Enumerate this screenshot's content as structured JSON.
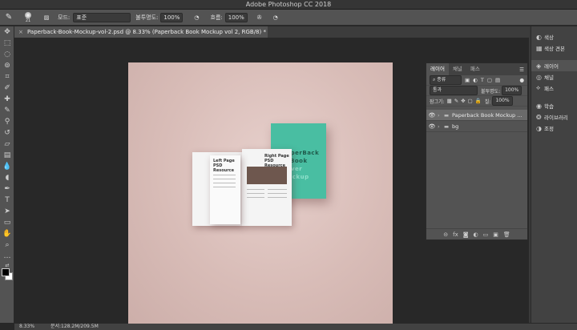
{
  "app": {
    "title": "Adobe Photoshop CC 2018"
  },
  "options_bar": {
    "brush_size": "21",
    "mode_label": "모드:",
    "mode_value": "표준",
    "opacity_label": "불투명도:",
    "opacity_value": "100%",
    "flow_label": "흐름:",
    "flow_value": "100%"
  },
  "document": {
    "tab_title": "Paperback-Book-Mockup-vol-2.psd @ 8.33% (Paperback Book Mockup vol 2, RGB/8) *",
    "close_glyph": "×"
  },
  "mockup": {
    "cover_lines": [
      "PaperBack",
      "Book",
      "Cover",
      "Mockup"
    ],
    "left_page_title": [
      "Left Page",
      "PSD Resource"
    ],
    "right_page_title": [
      "Right Page",
      "PSD Resource"
    ]
  },
  "right_dock": {
    "items": [
      {
        "icon": "◐",
        "label": "색상"
      },
      {
        "icon": "▦",
        "label": "색상 견본"
      },
      {
        "icon": "◈",
        "label": "레이어"
      },
      {
        "icon": "◎",
        "label": "채널"
      },
      {
        "icon": "⟡",
        "label": "패스"
      },
      {
        "icon": "◉",
        "label": "학습"
      },
      {
        "icon": "❂",
        "label": "라이브러리"
      },
      {
        "icon": "◑",
        "label": "조정"
      }
    ]
  },
  "layers_panel": {
    "tabs": [
      "레이어",
      "채널",
      "패스"
    ],
    "filter_label": "종류",
    "blend_mode": "통과",
    "opacity_label": "불투명도:",
    "opacity_value": "100%",
    "lock_label": "잠그기:",
    "fill_label": "칠:",
    "fill_value": "100%",
    "layers": [
      {
        "name": "Paperback Book Mockup ..."
      },
      {
        "name": "bg"
      }
    ],
    "bottom_icons": [
      "⊝",
      "fx",
      "◙",
      "◐",
      "▭",
      "▣",
      "🗑"
    ]
  },
  "statusbar": {
    "zoom": "8.33%",
    "doc_info": "문서:128.2M/209.5M"
  }
}
